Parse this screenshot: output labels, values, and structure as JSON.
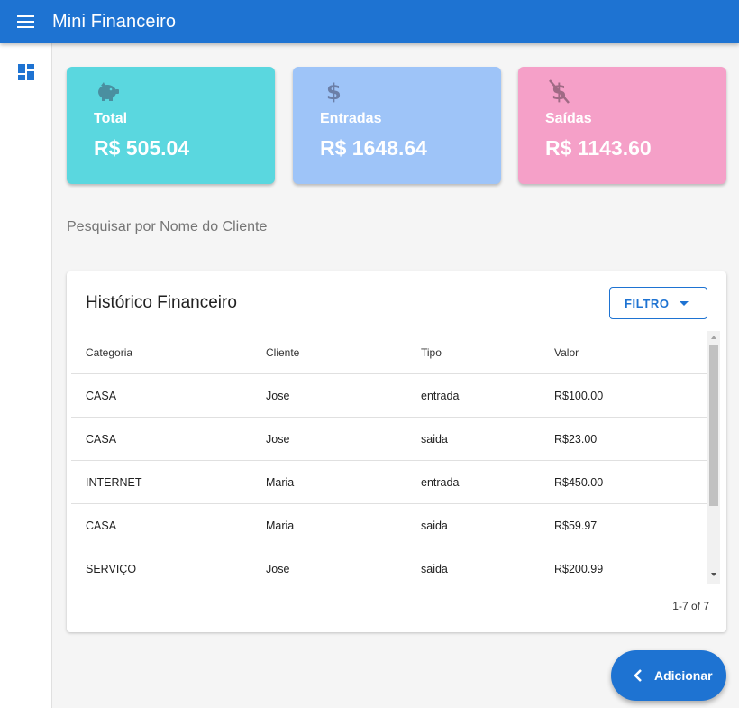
{
  "app": {
    "title": "Mini Financeiro"
  },
  "colors": {
    "primary": "#1e73d2",
    "total": "#5ad7df",
    "entradas": "#9ec4f8",
    "saidas": "#f5a0c8"
  },
  "cards": [
    {
      "label": "Total",
      "value": "R$ 505.04",
      "icon": "piggy-bank-icon"
    },
    {
      "label": "Entradas",
      "value": "R$ 1648.64",
      "icon": "dollar-icon"
    },
    {
      "label": "Saídas",
      "value": "R$ 1143.60",
      "icon": "dollar-off-icon"
    }
  ],
  "search": {
    "placeholder": "Pesquisar por Nome do Cliente",
    "value": ""
  },
  "table": {
    "title": "Histórico Financeiro",
    "filter_label": "FILTRO",
    "headers": [
      "Categoria",
      "Cliente",
      "Tipo",
      "Valor"
    ],
    "rows": [
      [
        "CASA",
        "Jose",
        "entrada",
        "R$100.00"
      ],
      [
        "CASA",
        "Jose",
        "saida",
        "R$23.00"
      ],
      [
        "INTERNET",
        "Maria",
        "entrada",
        "R$450.00"
      ],
      [
        "CASA",
        "Maria",
        "saida",
        "R$59.97"
      ],
      [
        "SERVIÇO",
        "Jose",
        "saida",
        "R$200.99"
      ]
    ],
    "pagination": "1-7 of 7"
  },
  "fab": {
    "label": "Adicionar"
  }
}
